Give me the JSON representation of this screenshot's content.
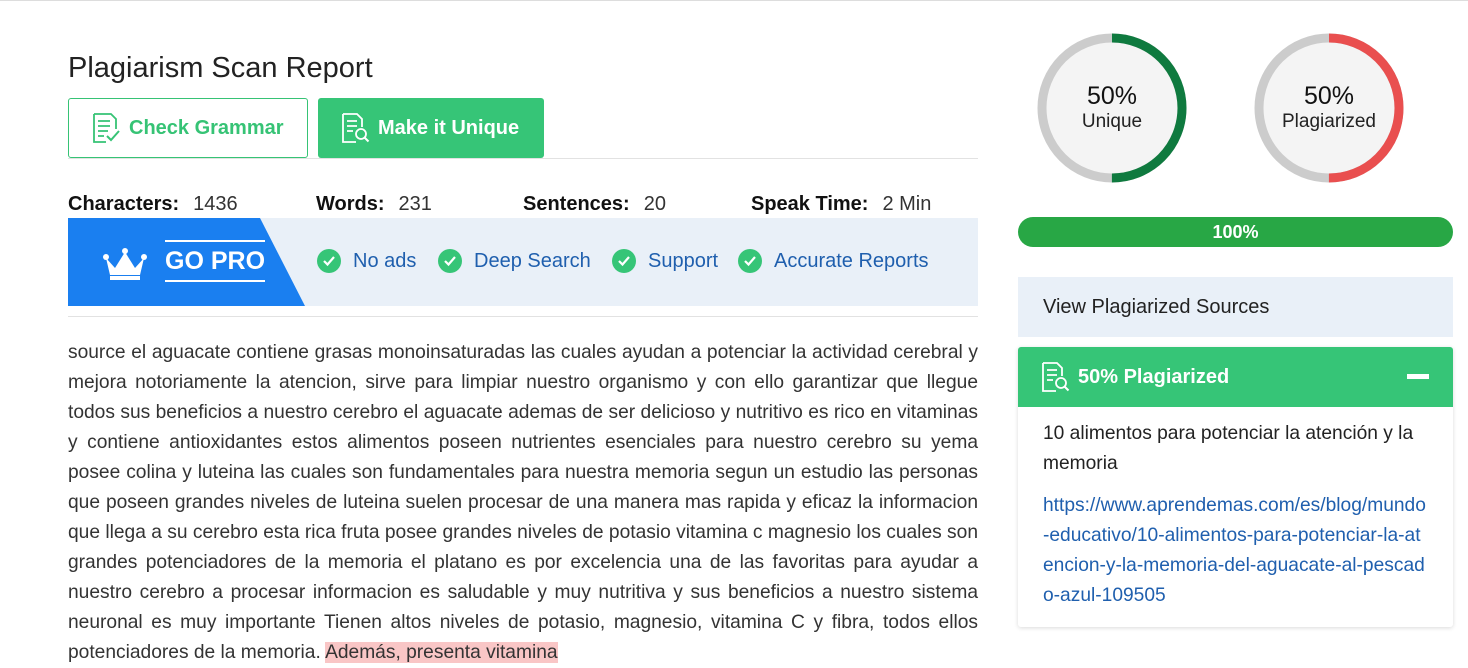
{
  "report": {
    "title": "Plagiarism Scan Report",
    "buttons": {
      "check_grammar": "Check Grammar",
      "make_unique": "Make it Unique"
    },
    "stats": [
      {
        "label": "Characters:",
        "value": "1436"
      },
      {
        "label": "Words:",
        "value": "231"
      },
      {
        "label": "Sentences:",
        "value": "20"
      },
      {
        "label": "Speak Time:",
        "value": "2 Min"
      }
    ],
    "gopro": {
      "label": "GO PRO",
      "features": [
        "No ads",
        "Deep Search",
        "Support",
        "Accurate Reports"
      ]
    },
    "content": {
      "text": "source el aguacate contiene grasas monoinsaturadas las cuales ayudan a potenciar la actividad cerebral y mejora notoriamente la atencion, sirve para limpiar nuestro organismo y con ello garantizar que llegue todos sus beneficios a nuestro cerebro el aguacate ademas de ser delicioso y nutritivo es rico en vitaminas y contiene antioxidantes estos alimentos poseen nutrientes esenciales para nuestro cerebro su yema posee colina y luteina las cuales son fundamentales para nuestra memoria segun un estudio las personas que poseen grandes niveles de luteina suelen procesar de una manera mas rapida y eficaz la informacion que llega a su cerebro esta rica fruta posee grandes niveles de potasio vitamina c magnesio los cuales son grandes potenciadores de la memoria el platano es por excelencia una de las favoritas para ayudar a nuestro cerebro a procesar informacion es saludable y muy nutritiva y sus beneficios a nuestro sistema neuronal es muy importante Tienen altos niveles de potasio, magnesio, vitamina C y fibra, todos ellos potenciadores de la memoria.",
      "highlighted": "Además, presenta vitamina"
    }
  },
  "summary": {
    "unique": {
      "percent": "50%",
      "label": "Unique",
      "value": 50,
      "color": "#0f7a3f"
    },
    "plagiarized": {
      "percent": "50%",
      "label": "Plagiarized",
      "value": 50,
      "color": "#e94f4f"
    },
    "progress": {
      "label": "100%",
      "value": 100
    },
    "sources_header": "View Plagiarized Sources",
    "source_card": {
      "header": "50% Plagiarized",
      "title": "10 alimentos para potenciar la atención y la memoria",
      "url": "https://www.aprendemas.com/es/blog/mundo-educativo/10-alimentos-para-potenciar-la-atencion-y-la-memoria-del-aguacate-al-pescado-azul-109505"
    }
  }
}
